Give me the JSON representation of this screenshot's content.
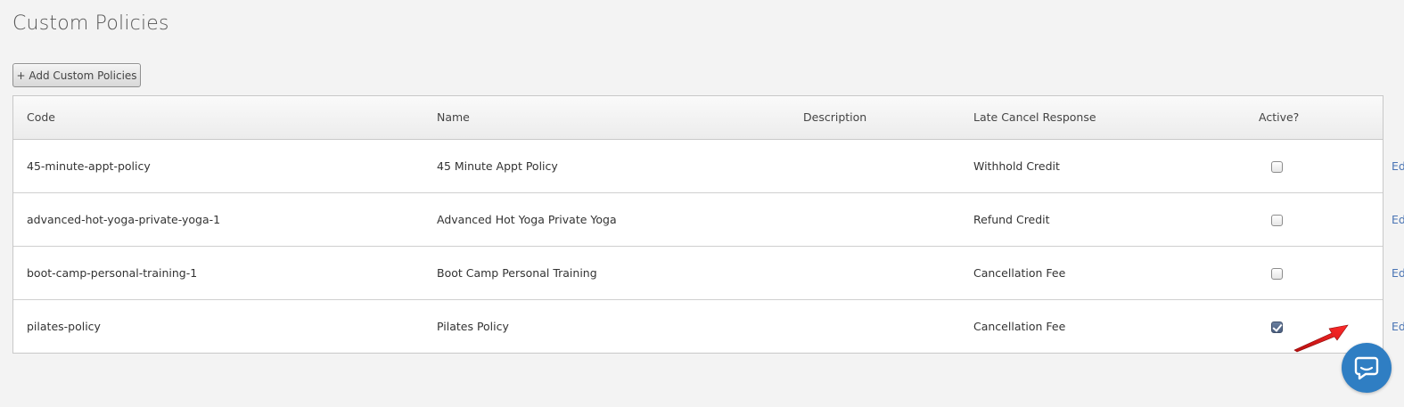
{
  "page": {
    "title": "Custom Policies"
  },
  "toolbar": {
    "add_label": "+ Add Custom Policies"
  },
  "table": {
    "headers": {
      "code": "Code",
      "name": "Name",
      "description": "Description",
      "late_cancel": "Late Cancel Response",
      "active": "Active?"
    },
    "rows": [
      {
        "code": "45-minute-appt-policy",
        "name": "45 Minute Appt Policy",
        "description": "",
        "late_cancel": "Withhold Credit",
        "active": false,
        "edit_label": "Edit"
      },
      {
        "code": "advanced-hot-yoga-private-yoga-1",
        "name": "Advanced Hot Yoga Private Yoga",
        "description": "",
        "late_cancel": "Refund Credit",
        "active": false,
        "edit_label": "Edit"
      },
      {
        "code": "boot-camp-personal-training-1",
        "name": "Boot Camp Personal Training",
        "description": "",
        "late_cancel": "Cancellation Fee",
        "active": false,
        "edit_label": "Edit"
      },
      {
        "code": "pilates-policy",
        "name": "Pilates Policy",
        "description": "",
        "late_cancel": "Cancellation Fee",
        "active": true,
        "edit_label": "Edit"
      }
    ]
  },
  "annotation": {
    "arrow_color": "#e21b1b",
    "arrow_target": "row-4-edit-link"
  },
  "chat": {
    "icon": "chat-bubble-icon",
    "color": "#2f7ec3"
  },
  "colors": {
    "link": "#4a74b4",
    "background": "#f3f3f3"
  }
}
